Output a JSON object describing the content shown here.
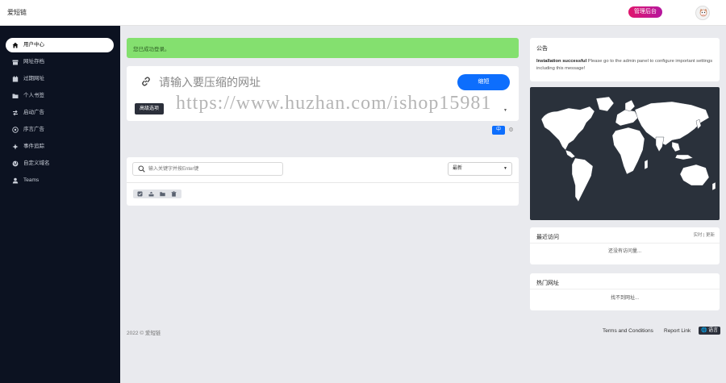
{
  "header": {
    "brand": "爱短链",
    "admin_label": "管理后台"
  },
  "sidebar": {
    "items": [
      {
        "label": "用户中心",
        "icon": "home-icon",
        "active": true
      },
      {
        "label": "网址存档",
        "icon": "archive-icon",
        "active": false
      },
      {
        "label": "过期网址",
        "icon": "calendar-icon",
        "active": false
      },
      {
        "label": "个人书签",
        "icon": "folder-icon",
        "active": false
      },
      {
        "label": "启动广告",
        "icon": "swap-icon",
        "active": false
      },
      {
        "label": "序言广告",
        "icon": "target-icon",
        "active": false
      },
      {
        "label": "事件追踪",
        "icon": "crosshair-icon",
        "active": false
      },
      {
        "label": "自定义域名",
        "icon": "globe-icon",
        "active": false
      },
      {
        "label": "Teams",
        "icon": "user-icon",
        "active": false
      }
    ]
  },
  "alert": {
    "text": "您已成功登录。"
  },
  "shorten": {
    "placeholder": "请输入要压缩的网址",
    "button": "缩短",
    "advanced": "高级选项"
  },
  "lang_toggle": {
    "zh": "中",
    "gear": "⚙"
  },
  "links": {
    "search_placeholder": "输入关键字并按Enter键",
    "sort_value": "最新"
  },
  "footer": {
    "copyright": "2022 © 爱短链",
    "terms": "Terms and Conditions",
    "report": "Report Link",
    "language": "语言"
  },
  "notice": {
    "title": "公告",
    "body_bold": "Installation successful",
    "body_rest": " Please go to the admin panel to configure important settings including this message!"
  },
  "visits": {
    "title": "最近访问",
    "switch": "实时 | 更新",
    "empty": "还没有访问量..."
  },
  "popular": {
    "title": "热门网址",
    "empty": "找不到网址..."
  },
  "watermark": "https://www.huzhan.com/ishop15981",
  "colors": {
    "sidebar_bg": "#0c1221",
    "primary": "#0d6efd",
    "alert_bg": "#84e06f",
    "admin_badge": "#e0166d",
    "map_bg": "#2a313b"
  }
}
